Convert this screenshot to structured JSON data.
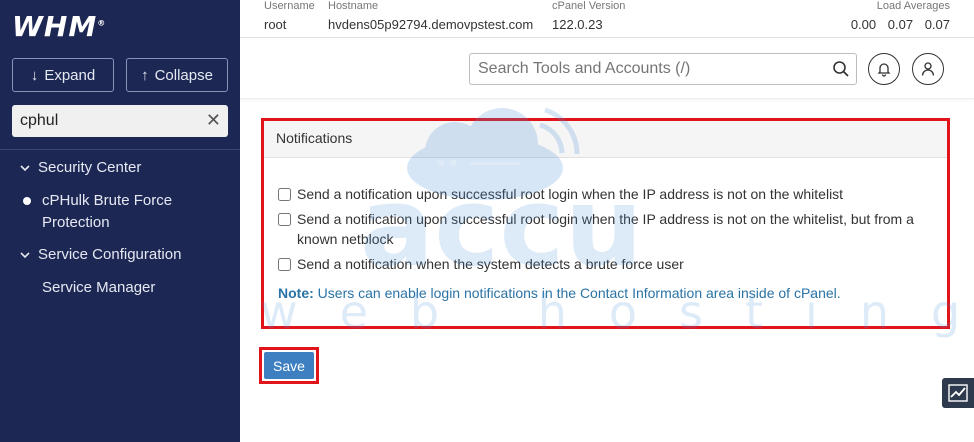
{
  "sidebar": {
    "logo": "WHM",
    "expand_label": "Expand",
    "collapse_label": "Collapse",
    "filter_value": "cphul",
    "groups": [
      {
        "label": "Security Center",
        "items": [
          "cPHulk Brute Force Protection"
        ]
      },
      {
        "label": "Service Configuration",
        "items": [
          "Service Manager"
        ]
      }
    ]
  },
  "topinfo": {
    "username_label": "Username",
    "username": "root",
    "hostname_label": "Hostname",
    "hostname": "hvdens05p92794.demovpstest.com",
    "version_label": "cPanel Version",
    "version": "122.0.23",
    "loads_label": "Load Averages",
    "loads": [
      "0.00",
      "0.07",
      "0.07"
    ]
  },
  "search": {
    "placeholder": "Search Tools and Accounts (/)"
  },
  "panel": {
    "title": "Notifications",
    "options": [
      "Send a notification upon successful root login when the IP address is not on the whitelist",
      "Send a notification upon successful root login when the IP address is not on the whitelist, but from a known netblock",
      "Send a notification when the system detects a brute force user"
    ],
    "note_label": "Note:",
    "note_text": "Users can enable login notifications in the Contact Information area inside of cPanel."
  },
  "save_label": "Save",
  "watermark": {
    "brand": "accu",
    "tagline": "web hosting"
  },
  "colors": {
    "sidebar_bg": "#1c2754",
    "highlight": "#e0151c",
    "primary_button": "#3d7fc1"
  }
}
